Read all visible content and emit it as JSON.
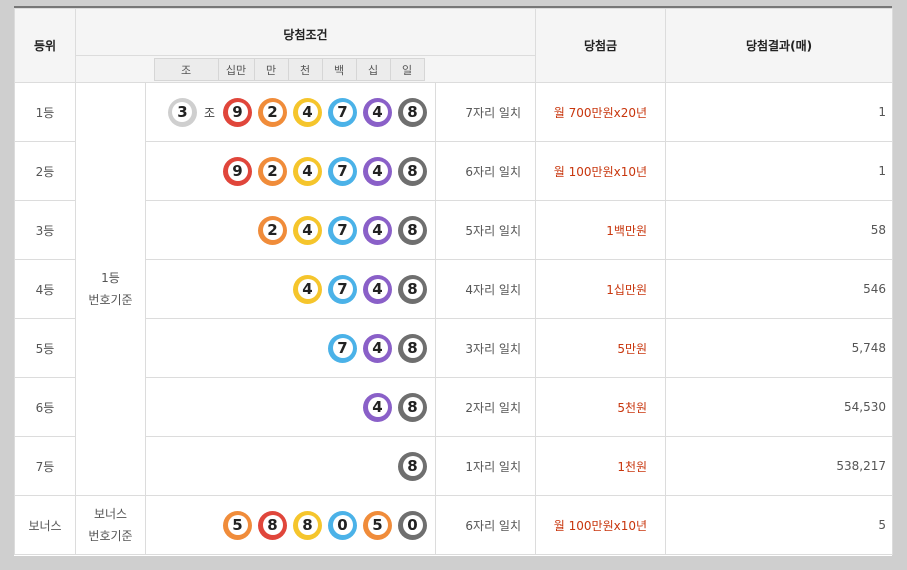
{
  "header": {
    "rank": "등위",
    "condition": "당첨조건",
    "prize": "당첨금",
    "result": "당첨결과(매)",
    "units": [
      "조",
      "십만",
      "만",
      "천",
      "백",
      "십",
      "일"
    ]
  },
  "basis_first": "1등\n번호기준",
  "basis_bonus": "보너스\n번호기준",
  "jo_label": "조",
  "rows": [
    {
      "rank": "1등",
      "jo": "3",
      "balls": [
        "9",
        "2",
        "4",
        "7",
        "4",
        "8"
      ],
      "match": "7자리 일치",
      "prize": "월 700만원x20년",
      "result": "1"
    },
    {
      "rank": "2등",
      "balls": [
        "9",
        "2",
        "4",
        "7",
        "4",
        "8"
      ],
      "match": "6자리 일치",
      "prize": "월 100만원x10년",
      "result": "1"
    },
    {
      "rank": "3등",
      "balls": [
        "2",
        "4",
        "7",
        "4",
        "8"
      ],
      "match": "5자리 일치",
      "prize": "1백만원",
      "result": "58"
    },
    {
      "rank": "4등",
      "balls": [
        "4",
        "7",
        "4",
        "8"
      ],
      "match": "4자리 일치",
      "prize": "1십만원",
      "result": "546"
    },
    {
      "rank": "5등",
      "balls": [
        "7",
        "4",
        "8"
      ],
      "match": "3자리 일치",
      "prize": "5만원",
      "result": "5,748"
    },
    {
      "rank": "6등",
      "balls": [
        "4",
        "8"
      ],
      "match": "2자리 일치",
      "prize": "5천원",
      "result": "54,530"
    },
    {
      "rank": "7등",
      "balls": [
        "8"
      ],
      "match": "1자리 일치",
      "prize": "1천원",
      "result": "538,217"
    },
    {
      "rank": "보너스",
      "balls": [
        "5",
        "8",
        "8",
        "0",
        "5",
        "0"
      ],
      "match": "6자리 일치",
      "prize": "월 100만원x10년",
      "result": "5"
    }
  ],
  "ball_colors": {
    "red": "#e0463b",
    "orange": "#f08c3a",
    "yellow": "#f5c52c",
    "blue": "#4bb2e8",
    "purple": "#8a60c8",
    "gray": "#6f6f6f",
    "white": "#cfcfcf"
  }
}
